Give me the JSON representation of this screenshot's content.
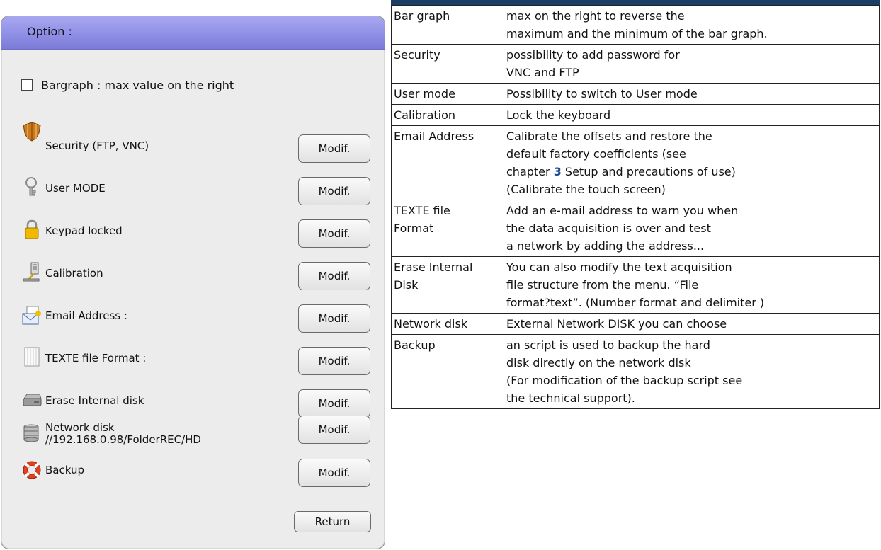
{
  "dialog": {
    "title": "Option :",
    "checkbox_label": "Bargraph : max value on the right",
    "button_label": "Modif.",
    "return_label": "Return",
    "options": [
      {
        "label": "Security (FTP, VNC)",
        "icon": "shield-icon"
      },
      {
        "label": "User MODE",
        "icon": "keys-icon"
      },
      {
        "label": "Keypad locked",
        "icon": "padlock-icon"
      },
      {
        "label": "Calibration",
        "icon": "calibration-icon"
      },
      {
        "label": "Email Address :",
        "icon": "email-icon"
      },
      {
        "label": "TEXTE file Format :",
        "icon": "text-file-icon"
      },
      {
        "label": "Erase Internal disk",
        "icon": "hard-disk-icon"
      },
      {
        "label": "Network disk",
        "sublabel": "//192.168.0.98/FolderREC/HD",
        "icon": "network-disk-icon"
      },
      {
        "label": "Backup",
        "icon": "lifebuoy-icon"
      }
    ]
  },
  "table": {
    "rows": [
      {
        "term": [
          "Bar graph"
        ],
        "desc": [
          "max on the right to reverse the",
          "maximum and the minimum of the bar graph."
        ]
      },
      {
        "term": [
          "Security"
        ],
        "desc": [
          "possibility to add password for",
          "VNC and FTP"
        ]
      },
      {
        "term": [
          "User mode"
        ],
        "desc": [
          "Possibility to switch to User mode"
        ]
      },
      {
        "term": [
          "Calibration"
        ],
        "desc": [
          "Lock the keyboard"
        ]
      },
      {
        "term": [
          "Email Address"
        ],
        "desc": [
          "Calibrate the offsets and restore the",
          "default factory coefficients (see",
          "chapter",
          "3",
          "Setup and precautions of use)",
          "(Calibrate the touch screen)"
        ]
      },
      {
        "term": [
          "TEXTE file",
          "Format"
        ],
        "desc": [
          "Add an e-mail address to warn you when",
          "the data acquisition is over and test",
          "a network by adding the address..."
        ]
      },
      {
        "term": [
          "Erase Internal",
          "Disk"
        ],
        "desc": [
          "You can also modify the text acquisition",
          "file structure from the menu. “File",
          "format?text”. (Number format and delimiter )"
        ]
      },
      {
        "term": [
          "Network disk"
        ],
        "desc": [
          "External Network DISK you can choose"
        ]
      },
      {
        "term": [
          "Backup"
        ],
        "desc": [
          "an script is used to backup the hard",
          "disk directly on the network disk",
          "(For modification of the backup script see",
          "the technical support)."
        ]
      }
    ]
  }
}
